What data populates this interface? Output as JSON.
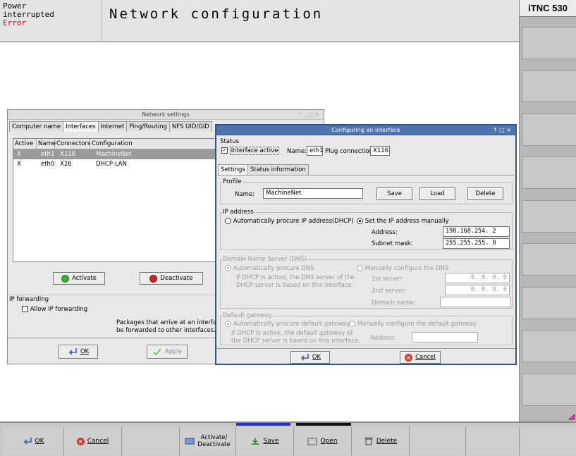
{
  "header": {
    "status_lines": [
      "Power",
      "interrupted"
    ],
    "error": "Error",
    "title": "Network configuration",
    "brand": "iTNC 530"
  },
  "network_settings": {
    "title": "Network settings",
    "tabs": [
      "Computer name",
      "Interfaces",
      "Internet",
      "Ping/Routing",
      "NFS UID/GID"
    ],
    "selected_tab": "Interfaces",
    "columns": [
      "Active",
      "Name",
      "Connectors",
      "Configuration"
    ],
    "rows": [
      {
        "active": "X",
        "name": "eth1",
        "connectors": "X116",
        "configuration": "MachineNet"
      },
      {
        "active": "X",
        "name": "eth0",
        "connectors": "X26",
        "configuration": "DHCP-LAN"
      }
    ],
    "activate": "Activate",
    "deactivate": "Deactivate",
    "ip_forwarding_label": "IP forwarding",
    "allow_ip_forwarding": "Allow IP forwarding",
    "note_line1": "Packages that arrive at an interface c",
    "note_line2": "be forwarded to other interfaces.",
    "ok": "OK",
    "apply": "Apply"
  },
  "config_dialog": {
    "title": "Configuring an interface",
    "status_label": "Status",
    "interface_active": "Interface active",
    "name_label": "Name:",
    "name_value": "eth1",
    "plug_label": "Plug connection:",
    "plug_value": "X116",
    "tabs": [
      "Settings",
      "Status information"
    ],
    "profile": {
      "label": "Profile",
      "name_label": "Name:",
      "name_value": "MachineNet",
      "save": "Save",
      "load": "Load",
      "delete": "Delete"
    },
    "ip": {
      "label": "IP address",
      "auto": "Automatically procure IP address(DHCP)",
      "manual": "Set the IP address manually",
      "address_label": "Address:",
      "address_value": "198.168.254.  2",
      "mask_label": "Subnet mask:",
      "mask_value": "255.255.255.  0"
    },
    "dns": {
      "label": "Domain Name Server (DNS)",
      "auto": "Automatically procure DNS",
      "manual": "Manually configure the DNS",
      "note1": "If DHCP is active, the DNS server of the",
      "note2": "DHCP server is based on this interface.",
      "server1_label": "1st server:",
      "server1_value": "0.  0.  0.  0",
      "server2_label": "2nd server:",
      "server2_value": "0.  0.  0.  0",
      "domain_label": "Domain name:"
    },
    "gateway": {
      "label": "Default gateway",
      "auto": "Automatically procure default gateway",
      "manual": "Manually configure the default gateway",
      "note1": "If DHCP is active, the default gateway of",
      "note2": "the DHCP server is based on this interface.",
      "address_label": "Address:"
    },
    "ok": "OK",
    "cancel": "Cancel"
  },
  "softkeys": {
    "ok": "OK",
    "cancel": "Cancel",
    "activate_l1": "Activate/",
    "activate_l2": "Deactivate",
    "save": "Save",
    "open": "Open",
    "delete": "Delete"
  }
}
